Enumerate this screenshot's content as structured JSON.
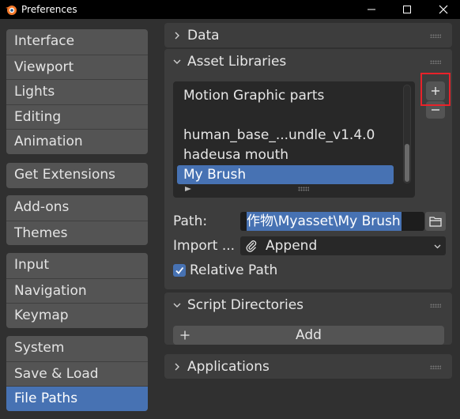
{
  "window": {
    "title": "Preferences",
    "logo_icon": "blender-logo-icon",
    "controls": [
      "minimize-icon",
      "maximize-icon",
      "close-icon"
    ]
  },
  "sidebar": {
    "groups": [
      {
        "items": [
          {
            "label": "Interface",
            "active": false
          },
          {
            "label": "Viewport",
            "active": false
          },
          {
            "label": "Lights",
            "active": false
          },
          {
            "label": "Editing",
            "active": false
          },
          {
            "label": "Animation",
            "active": false
          }
        ]
      },
      {
        "items": [
          {
            "label": "Get Extensions",
            "active": false
          }
        ]
      },
      {
        "items": [
          {
            "label": "Add-ons",
            "active": false
          },
          {
            "label": "Themes",
            "active": false
          }
        ]
      },
      {
        "items": [
          {
            "label": "Input",
            "active": false
          },
          {
            "label": "Navigation",
            "active": false
          },
          {
            "label": "Keymap",
            "active": false
          }
        ]
      },
      {
        "items": [
          {
            "label": "System",
            "active": false
          },
          {
            "label": "Save & Load",
            "active": false
          },
          {
            "label": "File Paths",
            "active": true
          }
        ]
      }
    ]
  },
  "main": {
    "data_section": {
      "title": "Data",
      "expanded": false
    },
    "asset_libraries": {
      "title": "Asset Libraries",
      "expanded": true,
      "libraries": [
        {
          "name": "Motion Graphic parts",
          "selected": false
        },
        {
          "name": "human_base_...undle_v1.4.0",
          "selected": false
        },
        {
          "name": "hadeusa mouth",
          "selected": false
        },
        {
          "name": "My Brush",
          "selected": true
        }
      ],
      "add_icon": "plus-icon",
      "remove_icon": "minus-icon",
      "path_label": "Path:",
      "path_value": "作物\\Myasset\\My Brush",
      "import_label": "Import ...",
      "import_value": "Append",
      "import_icon": "paperclip-icon",
      "relative_path_label": "Relative Path",
      "relative_path_checked": true
    },
    "script_directories": {
      "title": "Script Directories",
      "expanded": true,
      "add_label": "Add"
    },
    "applications": {
      "title": "Applications",
      "expanded": false
    }
  },
  "colors": {
    "accent": "#4772b3",
    "highlight_annotation": "#e8222a",
    "panel": "#303030",
    "section": "#3d3d3d"
  }
}
